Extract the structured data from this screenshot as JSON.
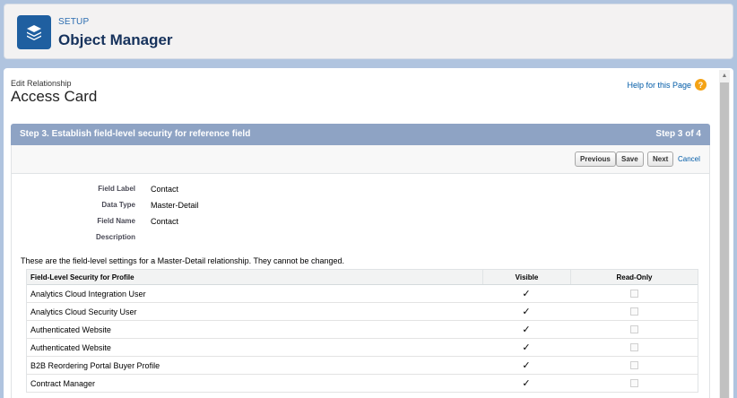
{
  "header": {
    "setup_label": "SETUP",
    "title": "Object Manager",
    "icon": "layers-icon"
  },
  "page": {
    "crumb_sub": "Edit Relationship",
    "crumb_main": "Access Card",
    "help_label": "Help for this Page"
  },
  "step": {
    "title": "Step 3. Establish field-level security for reference field",
    "counter": "Step 3 of 4"
  },
  "buttons": {
    "previous": "Previous",
    "save": "Save",
    "next": "Next",
    "cancel": "Cancel"
  },
  "fields": [
    {
      "label": "Field Label",
      "value": "Contact"
    },
    {
      "label": "Data Type",
      "value": "Master-Detail"
    },
    {
      "label": "Field Name",
      "value": "Contact"
    },
    {
      "label": "Description",
      "value": ""
    }
  ],
  "note": "These are the field-level settings for a Master-Detail relationship. They cannot be changed.",
  "table": {
    "headers": [
      "Field-Level Security for Profile",
      "Visible",
      "Read-Only"
    ],
    "rows": [
      {
        "profile": "Analytics Cloud Integration User",
        "visible": true,
        "read_only": false
      },
      {
        "profile": "Analytics Cloud Security User",
        "visible": true,
        "read_only": false
      },
      {
        "profile": "Authenticated Website",
        "visible": true,
        "read_only": false
      },
      {
        "profile": "Authenticated Website",
        "visible": true,
        "read_only": false
      },
      {
        "profile": "B2B Reordering Portal Buyer Profile",
        "visible": true,
        "read_only": false
      },
      {
        "profile": "Contract Manager",
        "visible": true,
        "read_only": false
      }
    ]
  }
}
